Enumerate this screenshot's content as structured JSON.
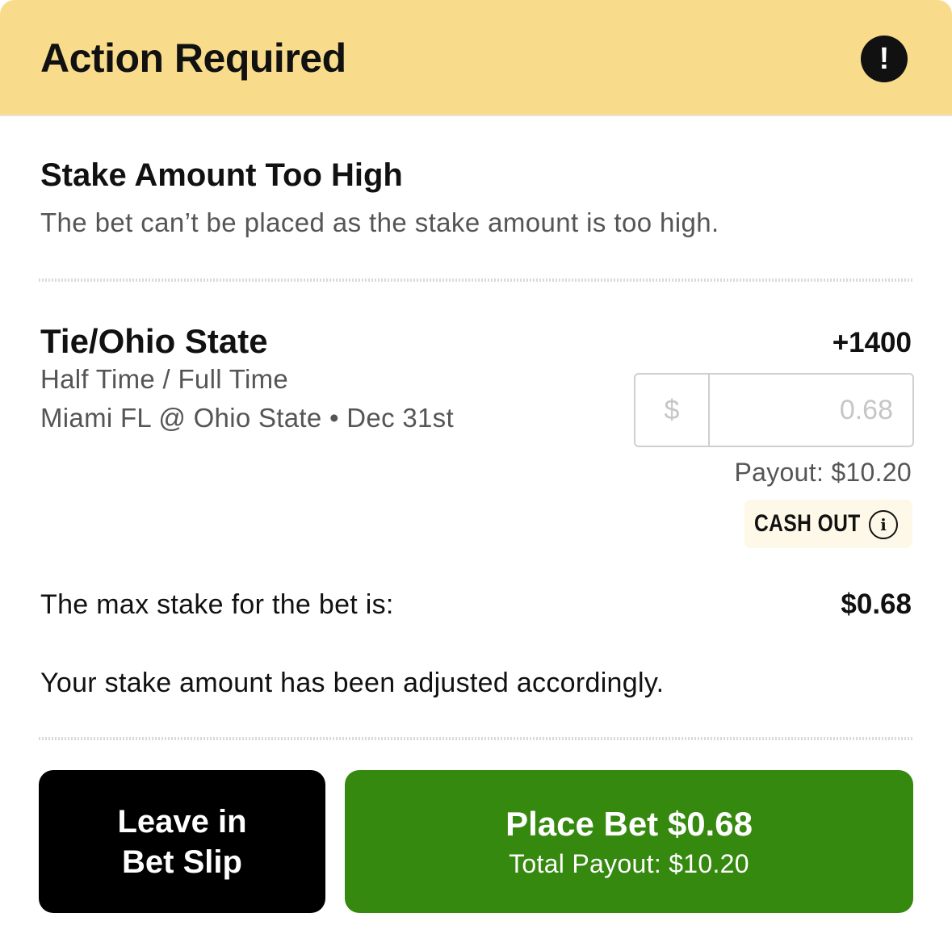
{
  "header": {
    "title": "Action Required",
    "alert_icon": "!",
    "background_color": "#f8dc8c"
  },
  "message": {
    "title": "Stake Amount Too High",
    "description": "The bet can’t be placed as the stake amount is too high."
  },
  "selection": {
    "name": "Tie/Ohio State",
    "odds": "+1400",
    "market": "Half Time / Full Time",
    "event": "Miami FL @ Ohio State • Dec 31st",
    "stake": {
      "currency_symbol": "$",
      "value": "0.68"
    },
    "payout": "Payout: $10.20",
    "cash_out": {
      "label": "CASH OUT",
      "info_icon": "i"
    }
  },
  "max_stake": {
    "label": "The max stake for the bet is:",
    "value": "$0.68"
  },
  "adjusted_note": "Your stake amount has been adjusted accordingly.",
  "buttons": {
    "leave": {
      "line1": "Leave in",
      "line2": "Bet Slip"
    },
    "place": {
      "label": "Place Bet $0.68",
      "sub_label": "Total Payout: $10.20",
      "color": "#35890e"
    }
  }
}
